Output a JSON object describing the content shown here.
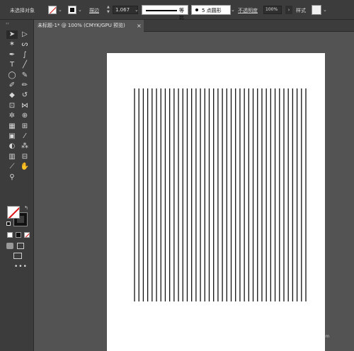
{
  "control_bar": {
    "selection_status": "未选择对象",
    "stroke_label": "描边",
    "stroke_weight": "1.067",
    "profile_label": "等比",
    "brush_label": "5 点圆形",
    "opacity_label": "不透明度",
    "opacity_value": "100%",
    "opacity_arrow": "›",
    "style_label": "样式",
    "dropdown_glyph": "⌄"
  },
  "tab": {
    "title": "未标题-1* @ 100% (CMYK/GPU 预览)",
    "close_glyph": "×"
  },
  "tools": {
    "grip": "‹‹",
    "icons": [
      "selection-icon",
      "direct-selection-icon",
      "magic-wand-icon",
      "lasso-icon",
      "pen-icon",
      "curvature-icon",
      "type-icon",
      "line-segment-icon",
      "ellipse-icon",
      "paintbrush-icon",
      "shaper-icon",
      "blob-brush-icon",
      "eraser-icon",
      "rotate-icon",
      "scale-icon",
      "width-icon",
      "puppet-warp-icon",
      "shape-builder-icon",
      "perspective-grid-icon",
      "mesh-icon",
      "gradient-icon",
      "eyedropper-icon",
      "blend-icon",
      "symbol-sprayer-icon",
      "column-graph-icon",
      "artboard-icon",
      "slice-icon",
      "hand-icon",
      "zoom-icon"
    ],
    "more": "•••"
  },
  "colors": {
    "fill": "none",
    "stroke": "#000000",
    "ui_dark": "#3c3c3c",
    "canvas_bg": "#535353",
    "stroke_line": "#111111"
  },
  "artwork": {
    "line_count": 40
  },
  "watermark": {
    "text": "Bai 经验",
    "sub": "jingyan.baidu.com"
  }
}
